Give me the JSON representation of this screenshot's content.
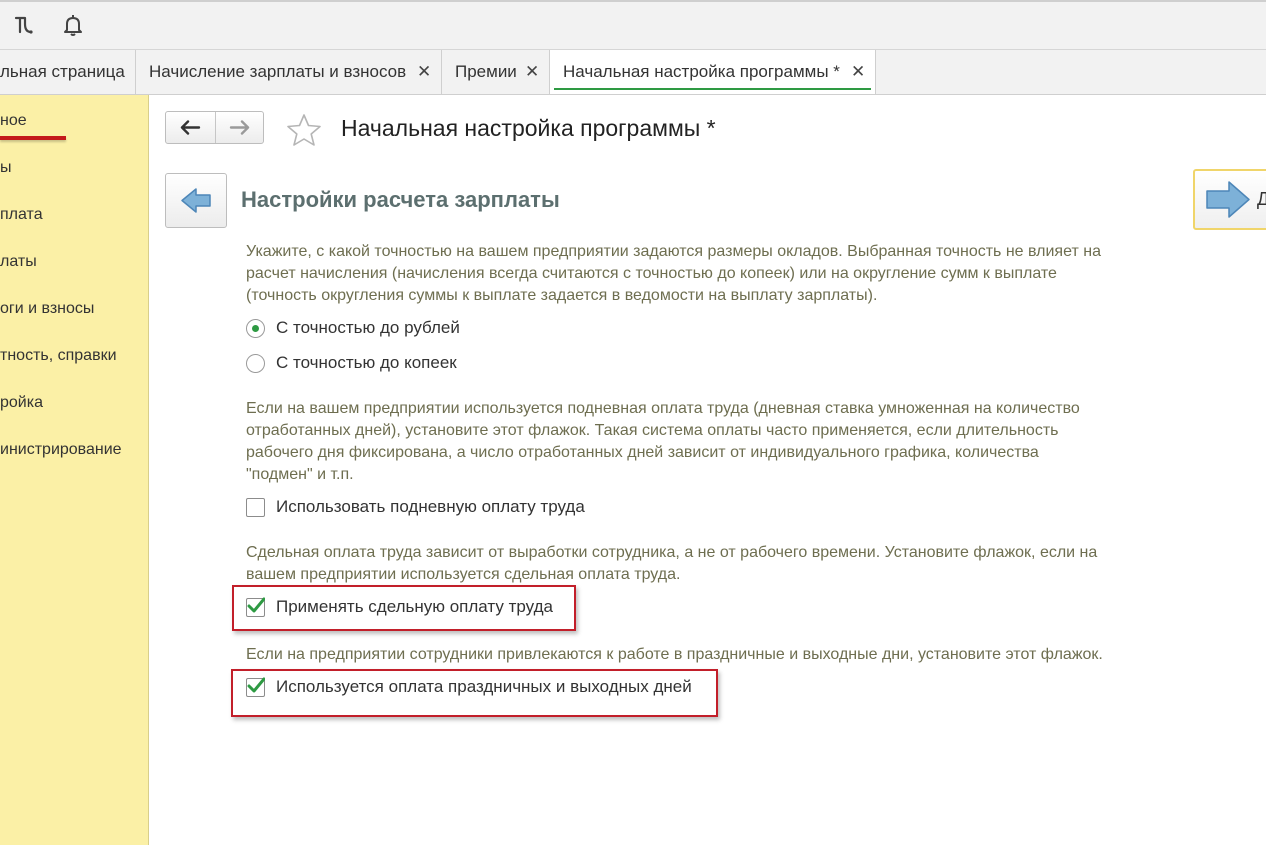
{
  "toolbar": {
    "icons": [
      "history-icon",
      "bell-icon"
    ]
  },
  "tabs": [
    {
      "label": "льная страница",
      "closable": false
    },
    {
      "label": "Начисление зарплаты и взносов",
      "closable": true
    },
    {
      "label": "Премии",
      "closable": true
    },
    {
      "label": "Начальная настройка программы *",
      "closable": true,
      "active": true
    }
  ],
  "tab_close_glyph": "✕",
  "sidebar": {
    "items": [
      {
        "label": "ное",
        "active": true
      },
      {
        "label": "ы"
      },
      {
        "label": "плата"
      },
      {
        "label": "латы"
      },
      {
        "label": "оги и взносы"
      },
      {
        "label": "тность, справки"
      },
      {
        "label": "ройка"
      },
      {
        "label": "инистрирование"
      }
    ]
  },
  "header": {
    "title": "Начальная настройка программы *"
  },
  "section": {
    "title": "Настройки расчета зарплаты",
    "next_label": "Д"
  },
  "content": {
    "para1": [
      "Укажите, с какой точностью на вашем предприятии задаются размеры окладов. Выбранная точность не влияет на",
      "расчет начисления (начисления всегда считаются с точностью до копеек) или на округление сумм к выплате",
      "(точность округления суммы к выплате задается в ведомости на выплату зарплаты)."
    ],
    "radio_rub": {
      "label": "С точностью до рублей",
      "selected": true
    },
    "radio_kop": {
      "label": "С точностью до копеек",
      "selected": false
    },
    "para2": [
      "Если на вашем предприятии используется подневная оплата труда (дневная ставка умноженная на количество",
      "отработанных дней), установите этот флажок. Такая система оплаты часто применяется, если длительность",
      "рабочего дня фиксирована, а число отработанных дней зависит от индивидуального графика, количества",
      "\"подмен\" и т.п."
    ],
    "chk_daily": {
      "label": "Использовать подневную оплату труда",
      "checked": false
    },
    "para3": [
      "Сдельная оплата труда зависит от выработки сотрудника, а не от рабочего времени. Установите флажок, если на",
      "вашем предприятии используется сдельная оплата труда."
    ],
    "chk_piece": {
      "label": "Применять сдельную оплату труда",
      "checked": true
    },
    "para4": [
      "Если на предприятии сотрудники привлекаются к работе в праздничные и выходные дни, установите этот флажок."
    ],
    "chk_holiday": {
      "label": "Используется оплата праздничных и выходных дней",
      "checked": true
    }
  },
  "colors": {
    "accent_green": "#2e9a43",
    "sidebar_bg": "#fbf0a6",
    "highlight_red": "#c21f2a",
    "section_title": "#5c6f6f",
    "hint_text": "#6e6e50"
  }
}
